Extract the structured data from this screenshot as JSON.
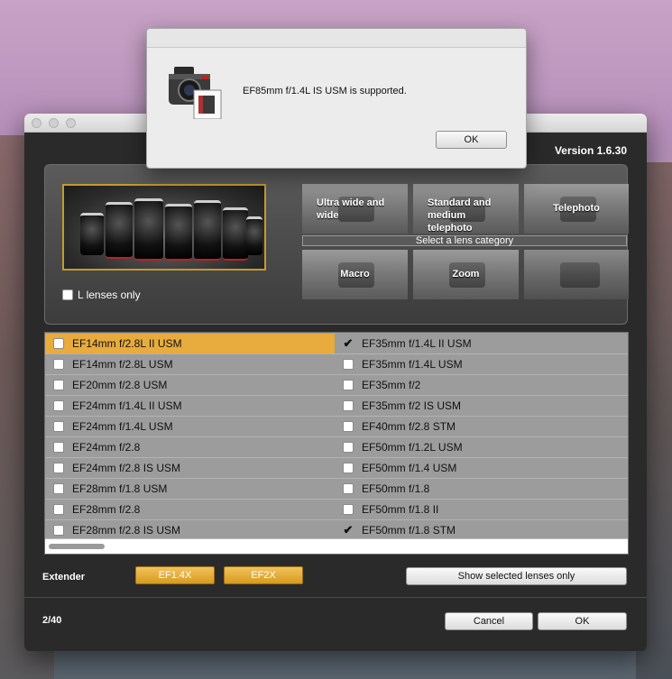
{
  "window": {
    "version": "Version 1.6.30",
    "l_lenses_only": "L lenses only",
    "categories": {
      "ultra_wide": "Ultra wide and wide",
      "standard": "Standard and medium telephoto",
      "telephoto": "Telephoto",
      "macro": "Macro",
      "zoom": "Zoom",
      "select_prompt": "Select a lens category"
    },
    "lenses_left": [
      {
        "name": "EF14mm f/2.8L II USM",
        "state": "selected"
      },
      {
        "name": "EF14mm f/2.8L USM",
        "state": "unchecked"
      },
      {
        "name": "EF20mm f/2.8 USM",
        "state": "unchecked"
      },
      {
        "name": "EF24mm f/1.4L II USM",
        "state": "unchecked"
      },
      {
        "name": "EF24mm f/1.4L USM",
        "state": "unchecked"
      },
      {
        "name": "EF24mm f/2.8",
        "state": "unchecked"
      },
      {
        "name": "EF24mm f/2.8 IS USM",
        "state": "unchecked"
      },
      {
        "name": "EF28mm f/1.8 USM",
        "state": "unchecked"
      },
      {
        "name": "EF28mm f/2.8",
        "state": "unchecked"
      },
      {
        "name": "EF28mm f/2.8 IS USM",
        "state": "unchecked"
      }
    ],
    "lenses_right": [
      {
        "name": "EF35mm f/1.4L II USM",
        "state": "checked"
      },
      {
        "name": "EF35mm f/1.4L USM",
        "state": "unchecked"
      },
      {
        "name": "EF35mm f/2",
        "state": "unchecked"
      },
      {
        "name": "EF35mm f/2 IS USM",
        "state": "unchecked"
      },
      {
        "name": "EF40mm f/2.8 STM",
        "state": "unchecked"
      },
      {
        "name": "EF50mm f/1.2L USM",
        "state": "unchecked"
      },
      {
        "name": "EF50mm f/1.4 USM",
        "state": "unchecked"
      },
      {
        "name": "EF50mm f/1.8",
        "state": "unchecked"
      },
      {
        "name": "EF50mm f/1.8 II",
        "state": "unchecked"
      },
      {
        "name": "EF50mm f/1.8 STM",
        "state": "checked"
      }
    ],
    "extender_label": "Extender",
    "extender_1": "EF1.4X",
    "extender_2": "EF2X",
    "show_selected": "Show selected lenses only",
    "count": "2/40",
    "cancel": "Cancel",
    "ok": "OK"
  },
  "alert": {
    "message": "EF85mm f/1.4L IS USM is supported.",
    "ok": "OK",
    "icon": "camera-icon"
  },
  "colors": {
    "selected_row": "#e8ab3d",
    "extender_button": "#e0a52e",
    "hero_border": "#c59a2e"
  }
}
